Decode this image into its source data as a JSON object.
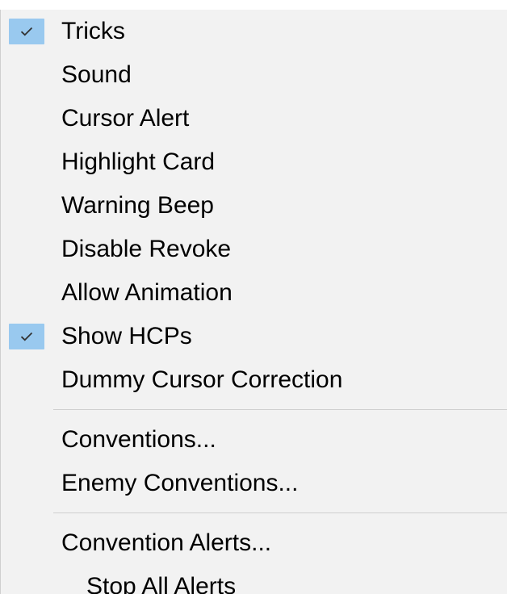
{
  "menu": {
    "items": [
      {
        "label": "Tricks",
        "checked": true
      },
      {
        "label": "Sound",
        "checked": false
      },
      {
        "label": "Cursor Alert",
        "checked": false
      },
      {
        "label": "Highlight Card",
        "checked": false
      },
      {
        "label": "Warning Beep",
        "checked": false
      },
      {
        "label": "Disable Revoke",
        "checked": false
      },
      {
        "label": "Allow Animation",
        "checked": false
      },
      {
        "label": "Show HCPs",
        "checked": true
      },
      {
        "label": "Dummy Cursor Correction",
        "checked": false
      },
      {
        "label": "Conventions...",
        "checked": false
      },
      {
        "label": "Enemy Conventions...",
        "checked": false
      },
      {
        "label": "Convention Alerts...",
        "checked": false
      },
      {
        "label": "Stop All Alerts",
        "checked": false
      }
    ],
    "icons": {
      "check": "checkmark-icon"
    },
    "colors": {
      "background": "#f2f2f2",
      "check_highlight": "#99c9ef",
      "separator": "#cfcfcf",
      "text": "#000000"
    }
  }
}
